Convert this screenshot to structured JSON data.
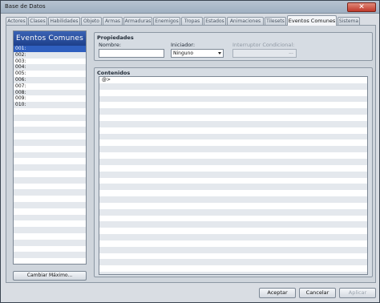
{
  "window": {
    "title": "Base de Datos"
  },
  "tabs": [
    {
      "label": "Actores"
    },
    {
      "label": "Clases"
    },
    {
      "label": "Habilidades"
    },
    {
      "label": "Objeto"
    },
    {
      "label": "Armas"
    },
    {
      "label": "Armaduras"
    },
    {
      "label": "Enemigos"
    },
    {
      "label": "Tropas"
    },
    {
      "label": "Estados"
    },
    {
      "label": "Animaciones"
    },
    {
      "label": "Tilesets"
    },
    {
      "label": "Eventos Comunes",
      "active": true
    },
    {
      "label": "Sistema"
    }
  ],
  "list": {
    "header": "Eventos Comunes",
    "items": [
      "001:",
      "002:",
      "003:",
      "004:",
      "005:",
      "006:",
      "007:",
      "008:",
      "009:",
      "010:"
    ],
    "selected_index": 0,
    "max_button": "Cambiar Máximo..."
  },
  "properties": {
    "title": "Propiedades",
    "name_label": "Nombre:",
    "name_value": "",
    "trigger_label": "Iniciador:",
    "trigger_value": "Ninguno",
    "switch_label": "Interruptor Condicional:",
    "switch_button": "..."
  },
  "contents": {
    "title": "Contenidos",
    "first_line": "@>"
  },
  "footer": {
    "accept": "Aceptar",
    "cancel": "Cancelar",
    "apply": "Aplicar"
  }
}
